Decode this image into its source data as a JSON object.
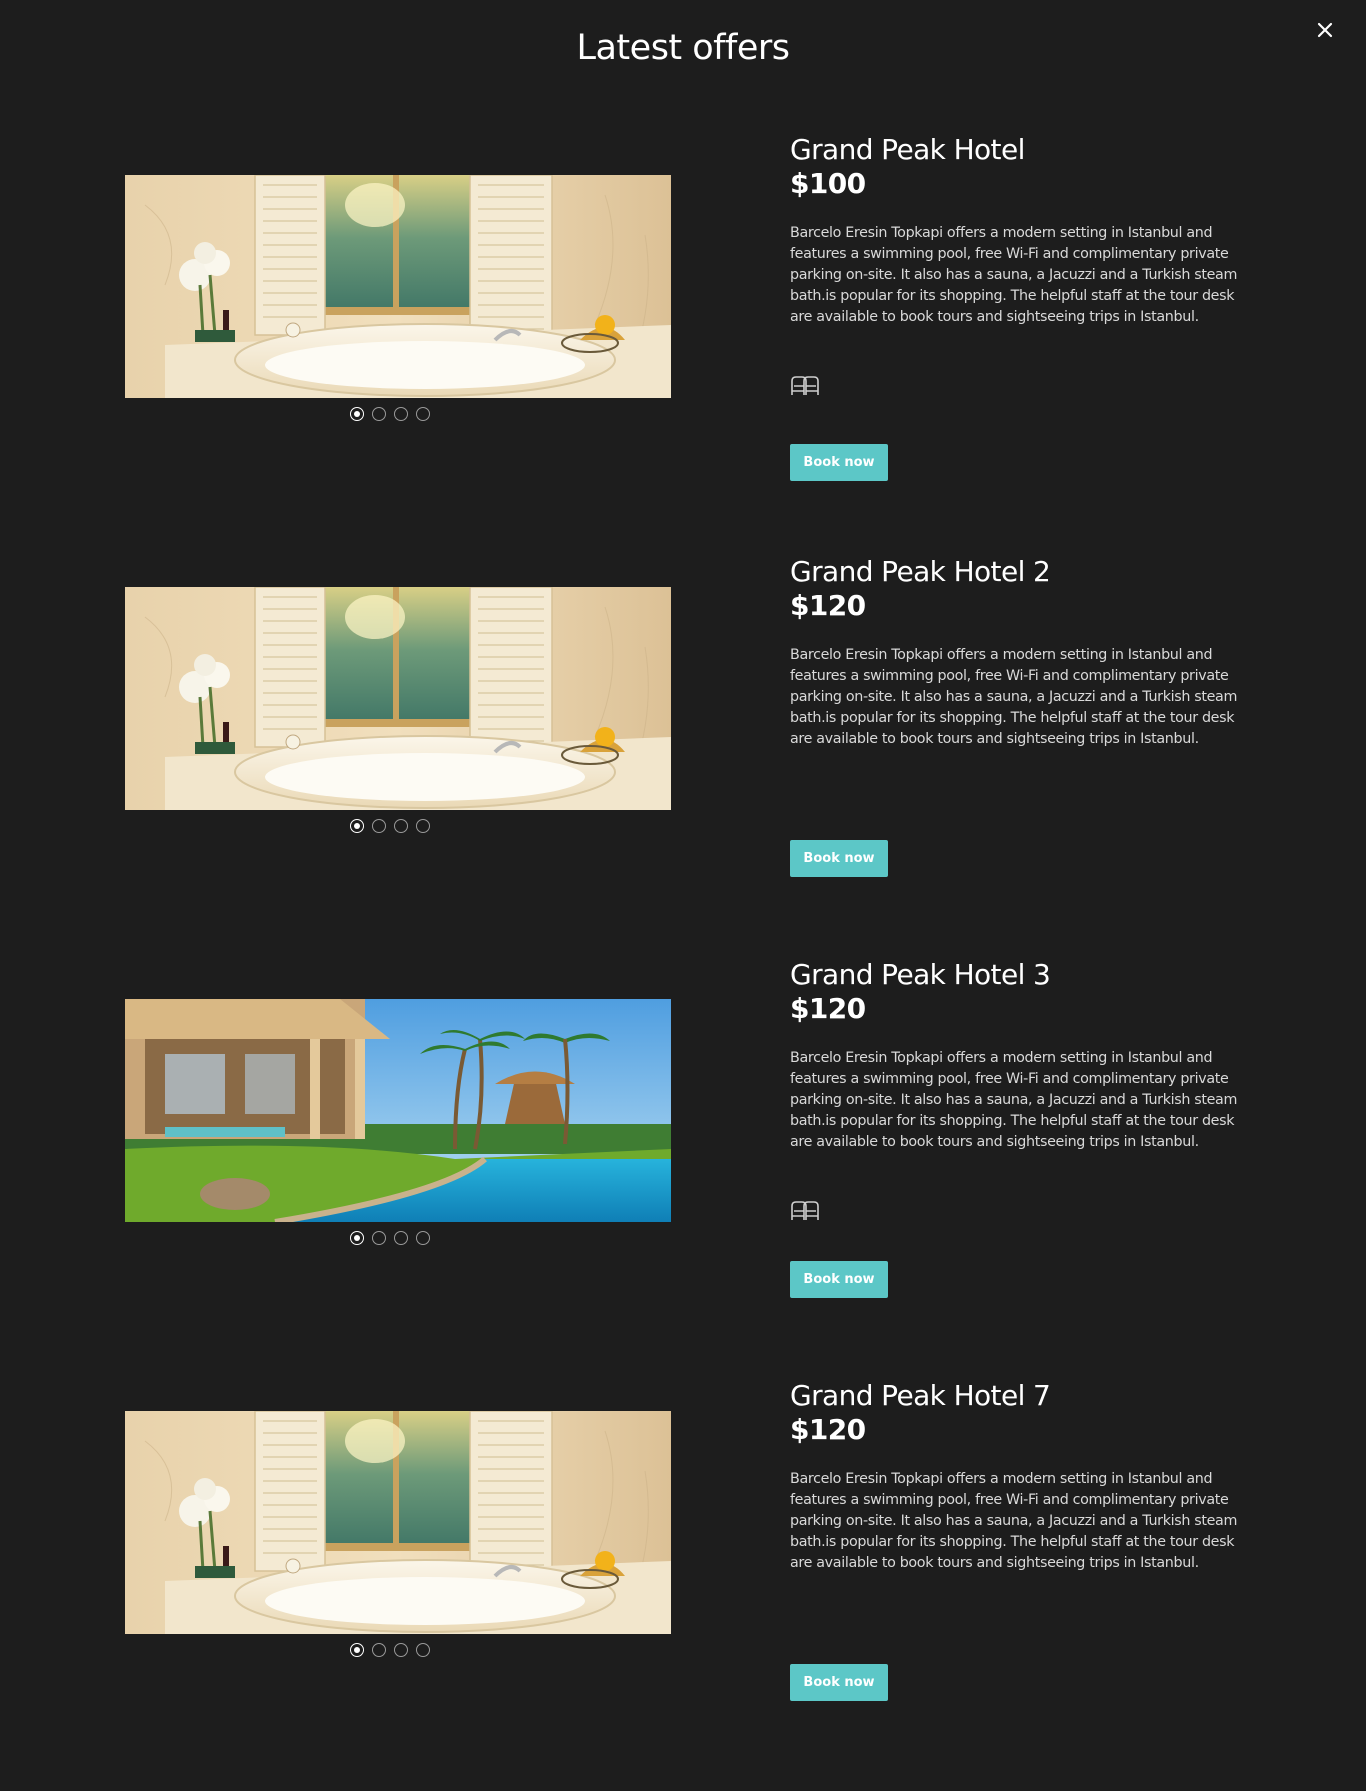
{
  "page": {
    "title": "Latest offers",
    "close_icon": "close-icon"
  },
  "offers": [
    {
      "name": "Grand Peak Hotel",
      "price": "$100",
      "description": "Barcelo Eresin Topkapi offers a modern setting in Istanbul and features a swimming pool, free Wi-Fi and complimentary private parking on-site. It also has a sauna, a Jacuzzi and a Turkish steam bath.is popular for its shopping. The helpful staff at the tour desk are available to book tours and sightseeing trips in Istanbul.",
      "image": "bathroom-jacuzzi",
      "slides": 4,
      "active_slide": 1,
      "amenity_icon": "twin-beds-icon",
      "book_label": "Book now"
    },
    {
      "name": "Grand Peak Hotel 2",
      "price": "$120",
      "description": "Barcelo Eresin Topkapi offers a modern setting in Istanbul and features a swimming pool, free Wi-Fi and complimentary private parking on-site. It also has a sauna, a Jacuzzi and a Turkish steam bath.is popular for its shopping. The helpful staff at the tour desk are available to book tours and sightseeing trips in Istanbul.",
      "image": "bathroom-jacuzzi",
      "slides": 4,
      "active_slide": 1,
      "amenity_icon": null,
      "book_label": "Book now"
    },
    {
      "name": "Grand Peak Hotel 3",
      "price": "$120",
      "description": "Barcelo Eresin Topkapi offers a modern setting in Istanbul and features a swimming pool, free Wi-Fi and complimentary private parking on-site. It also has a sauna, a Jacuzzi and a Turkish steam bath.is popular for its shopping. The helpful staff at the tour desk are available to book tours and sightseeing trips in Istanbul.",
      "image": "villa-pool",
      "slides": 4,
      "active_slide": 1,
      "amenity_icon": "twin-beds-icon",
      "book_label": "Book now"
    },
    {
      "name": "Grand Peak Hotel 7",
      "price": "$120",
      "description": "Barcelo Eresin Topkapi offers a modern setting in Istanbul and features a swimming pool, free Wi-Fi and complimentary private parking on-site. It also has a sauna, a Jacuzzi and a Turkish steam bath.is popular for its shopping. The helpful staff at the tour desk are available to book tours and sightseeing trips in Istanbul.",
      "image": "bathroom-jacuzzi",
      "slides": 4,
      "active_slide": 1,
      "amenity_icon": null,
      "book_label": "Book now"
    }
  ],
  "colors": {
    "background": "#1d1d1d",
    "accent": "#5cc7c7",
    "text": "#ffffff",
    "muted": "#d9d9d9"
  }
}
